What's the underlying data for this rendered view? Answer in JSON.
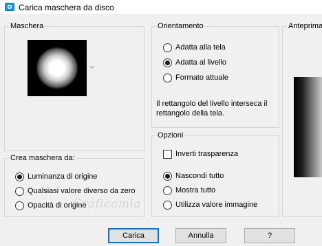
{
  "window": {
    "title": "Carica maschera da disco",
    "icon": "app-icon"
  },
  "mask": {
    "group_label": "Maschera"
  },
  "orientation": {
    "group_label": "Orientamento",
    "options": [
      "Adatta alla tela",
      "Adatta al livello",
      "Formato attuale"
    ],
    "selected": "Adatta al livello",
    "note": "Il rettangolo del livello interseca il rettangolo della tela."
  },
  "preview": {
    "group_label": "Anteprima"
  },
  "create_from": {
    "group_label": "Crea maschera da:",
    "options": [
      "Luminanza di origine",
      "Qualsiasi valore diverso da zero",
      "Opacità di origine"
    ],
    "selected": "Luminanza di origine"
  },
  "options": {
    "group_label": "Opzioni",
    "invert_label": "Inverti trasparenza",
    "invert_checked": false,
    "radio": [
      "Nascondi tutto",
      "Mostra tutto",
      "Utilizza valore immagine"
    ],
    "selected": "Nascondi tutto"
  },
  "buttons": {
    "load": "Carica",
    "cancel": "Annulla",
    "help": "?"
  },
  "watermark": "Graficamia",
  "colors": {
    "accent": "#0078d7",
    "background": "#f0f0f0"
  }
}
